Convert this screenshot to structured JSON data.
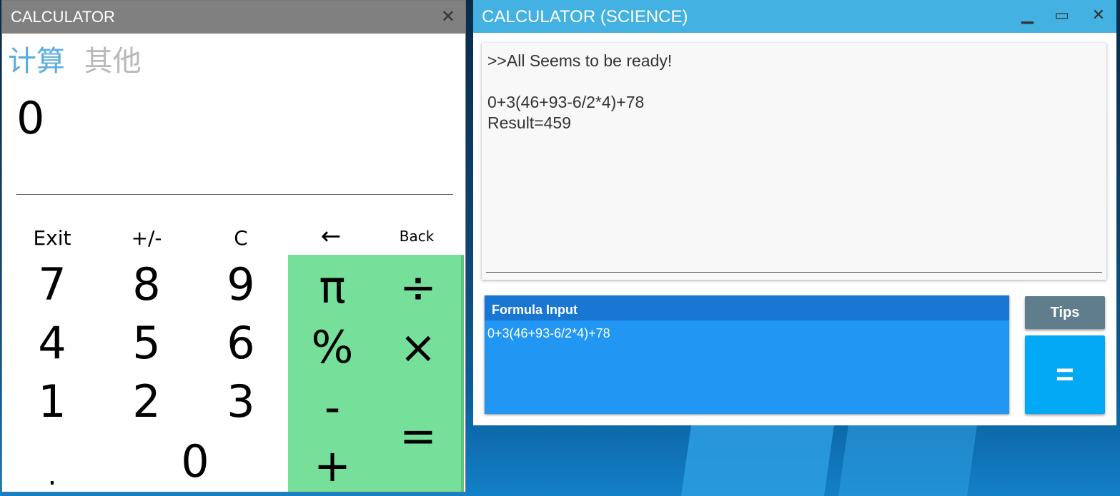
{
  "left_window": {
    "title": "CALCULATOR",
    "close_label": "✕",
    "tabs": [
      "计算",
      "其他"
    ],
    "display_value": "0",
    "keys": {
      "exit": "Exit",
      "sign": "+/-",
      "clear": "C",
      "backspace": "←",
      "back": "Back",
      "seven": "7",
      "eight": "8",
      "nine": "9",
      "four": "4",
      "five": "5",
      "six": "6",
      "one": "1",
      "two": "2",
      "three": "3",
      "dot": ".",
      "zero": "0",
      "pi": "π",
      "divide": "÷",
      "percent": "%",
      "multiply": "×",
      "minus": "-",
      "plus": "+",
      "equals": "="
    },
    "colors": {
      "titlebar": "#808080",
      "tab_active": "#59aee0",
      "tab_inactive": "#b8b8b8",
      "operator_pad": "#76df9a"
    }
  },
  "right_window": {
    "title": "CALCULATOR (SCIENCE)",
    "minimize_label": "▁",
    "maximize_label": "▭",
    "close_label": "✕",
    "console_lines": [
      ">>All Seems to be ready!",
      "0+3(46+93-6/2*4)+78",
      "Result=459"
    ],
    "formula_header": "Formula Input",
    "formula_value": "0+3(46+93-6/2*4)+78",
    "tips_label": "Tips",
    "equals_label": "=",
    "colors": {
      "titlebar": "#43b1e1",
      "formula_bg": "#2196f3",
      "formula_header": "#1976d2",
      "tips_bg": "#607d8b",
      "equals_bg": "#03a9f4"
    }
  }
}
